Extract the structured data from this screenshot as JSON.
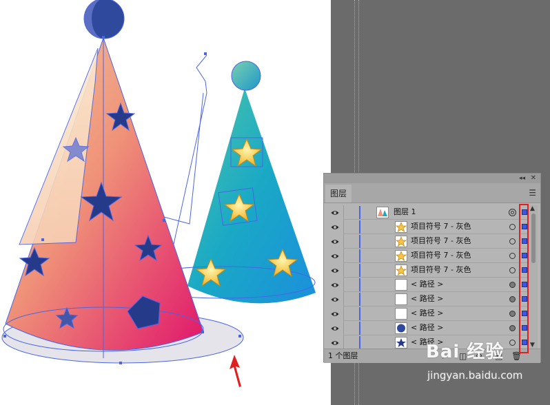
{
  "panel": {
    "tab_title": "图层",
    "layer_count": "1 个图层",
    "collapse_icon": "double-arrow-collapse-icon",
    "close_icon": "close-icon",
    "menu_icon": "hamburger-menu-icon"
  },
  "layers": [
    {
      "name": "图层 1",
      "thumb": "layer-preview",
      "target": "double"
    },
    {
      "name": "项目符号 7 - 灰色",
      "thumb": "star",
      "target": "open"
    },
    {
      "name": "项目符号 7 - 灰色",
      "thumb": "star",
      "target": "open"
    },
    {
      "name": "项目符号 7 - 灰色",
      "thumb": "star",
      "target": "open"
    },
    {
      "name": "项目符号 7 - 灰色",
      "thumb": "star",
      "target": "open"
    },
    {
      "name": "< 路径 >",
      "thumb": "blank",
      "target": "filled"
    },
    {
      "name": "< 路径 >",
      "thumb": "blank",
      "target": "filled"
    },
    {
      "name": "< 路径 >",
      "thumb": "blank",
      "target": "filled"
    },
    {
      "name": "< 路径 >",
      "thumb": "circle",
      "target": "filled"
    },
    {
      "name": "< 路径 >",
      "thumb": "navy-star",
      "target": "open"
    }
  ],
  "footer_icons": [
    "search-icon",
    "clipping-mask-icon",
    "new-sublayer-icon",
    "new-layer-icon",
    "trash-icon"
  ],
  "watermark": {
    "brand": "Bai 经验",
    "url": "jingyan.baidu.com"
  },
  "colors": {
    "selection_blue": "#3b57e0",
    "highlight_red": "#e02020",
    "pasteboard": "#6b6b6b",
    "panel_bg": "#b5b5b5"
  }
}
